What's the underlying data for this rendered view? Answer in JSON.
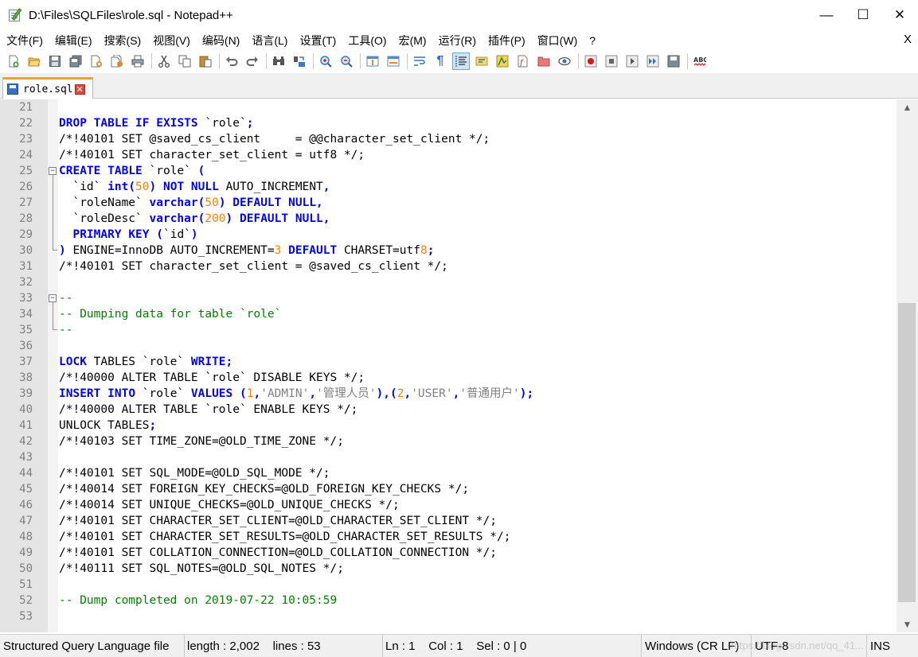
{
  "window": {
    "title": "D:\\Files\\SQLFiles\\role.sql - Notepad++",
    "minimize": "—",
    "maximize": "☐",
    "close": "✕"
  },
  "menu": {
    "items": [
      "文件(F)",
      "编辑(E)",
      "搜索(S)",
      "视图(V)",
      "编码(N)",
      "语言(L)",
      "设置(T)",
      "工具(O)",
      "宏(M)",
      "运行(R)",
      "插件(P)",
      "窗口(W)",
      "?"
    ],
    "close": "X"
  },
  "toolbar": {
    "buttons": [
      "new-file",
      "open-file",
      "save",
      "save-all",
      "close",
      "close-all",
      "print",
      "cut",
      "copy",
      "paste",
      "undo",
      "redo",
      "find",
      "replace",
      "zoom-in",
      "zoom-out",
      "sync-vertical",
      "sync-horizontal",
      "word-wrap",
      "show-all-chars",
      "indent-guide",
      "user-defined-language",
      "document-map",
      "function-list",
      "folder-as-workspace",
      "monitor",
      "macro-record",
      "macro-stop",
      "macro-play",
      "macro-run-multiple",
      "macro-save",
      "spell-check"
    ]
  },
  "tab": {
    "label": "role.sql",
    "close": "✕"
  },
  "editor": {
    "lines": [
      {
        "n": "21",
        "t": ""
      },
      {
        "n": "22",
        "t": "DROP TABLE IF EXISTS `role`;"
      },
      {
        "n": "23",
        "t": "/*!40101 SET @saved_cs_client     = @@character_set_client */;"
      },
      {
        "n": "24",
        "t": "/*!40101 SET character_set_client = utf8 */;"
      },
      {
        "n": "25",
        "t": "CREATE TABLE `role` ("
      },
      {
        "n": "26",
        "t": "  `id` int(50) NOT NULL AUTO_INCREMENT,"
      },
      {
        "n": "27",
        "t": "  `roleName` varchar(50) DEFAULT NULL,"
      },
      {
        "n": "28",
        "t": "  `roleDesc` varchar(200) DEFAULT NULL,"
      },
      {
        "n": "29",
        "t": "  PRIMARY KEY (`id`)"
      },
      {
        "n": "30",
        "t": ") ENGINE=InnoDB AUTO_INCREMENT=3 DEFAULT CHARSET=utf8;"
      },
      {
        "n": "31",
        "t": "/*!40101 SET character_set_client = @saved_cs_client */;"
      },
      {
        "n": "32",
        "t": ""
      },
      {
        "n": "33",
        "t": "--"
      },
      {
        "n": "34",
        "t": "-- Dumping data for table `role`"
      },
      {
        "n": "35",
        "t": "--"
      },
      {
        "n": "36",
        "t": ""
      },
      {
        "n": "37",
        "t": "LOCK TABLES `role` WRITE;"
      },
      {
        "n": "38",
        "t": "/*!40000 ALTER TABLE `role` DISABLE KEYS */;"
      },
      {
        "n": "39",
        "t": "INSERT INTO `role` VALUES (1,'ADMIN','管理人员'),(2,'USER','普通用户');"
      },
      {
        "n": "40",
        "t": "/*!40000 ALTER TABLE `role` ENABLE KEYS */;"
      },
      {
        "n": "41",
        "t": "UNLOCK TABLES;"
      },
      {
        "n": "42",
        "t": "/*!40103 SET TIME_ZONE=@OLD_TIME_ZONE */;"
      },
      {
        "n": "43",
        "t": ""
      },
      {
        "n": "44",
        "t": "/*!40101 SET SQL_MODE=@OLD_SQL_MODE */;"
      },
      {
        "n": "45",
        "t": "/*!40014 SET FOREIGN_KEY_CHECKS=@OLD_FOREIGN_KEY_CHECKS */;"
      },
      {
        "n": "46",
        "t": "/*!40014 SET UNIQUE_CHECKS=@OLD_UNIQUE_CHECKS */;"
      },
      {
        "n": "47",
        "t": "/*!40101 SET CHARACTER_SET_CLIENT=@OLD_CHARACTER_SET_CLIENT */;"
      },
      {
        "n": "48",
        "t": "/*!40101 SET CHARACTER_SET_RESULTS=@OLD_CHARACTER_SET_RESULTS */;"
      },
      {
        "n": "49",
        "t": "/*!40101 SET COLLATION_CONNECTION=@OLD_COLLATION_CONNECTION */;"
      },
      {
        "n": "50",
        "t": "/*!40111 SET SQL_NOTES=@OLD_SQL_NOTES */;"
      },
      {
        "n": "51",
        "t": ""
      },
      {
        "n": "52",
        "t": "-- Dump completed on 2019-07-22 10:05:59"
      },
      {
        "n": "53",
        "t": ""
      }
    ],
    "keywords": [
      "DROP",
      "TABLE",
      "IF",
      "EXISTS",
      "CREATE",
      "int",
      "NOT",
      "NULL",
      "varchar",
      "DEFAULT",
      "PRIMARY",
      "KEY",
      "LOCK",
      "WRITE",
      "INSERT",
      "INTO",
      "VALUES"
    ],
    "colors": {
      "keyword": "#0000ff",
      "number": "#ff8000",
      "string": "#808080",
      "comment": "#008000",
      "line_number": "#808080"
    }
  },
  "scrollbar": {
    "up": "▲",
    "down": "▼"
  },
  "status": {
    "language": "Structured Query Language file",
    "length": "length : 2,002",
    "lines": "lines : 53",
    "ln": "Ln : 1",
    "col": "Col : 1",
    "sel": "Sel : 0 | 0",
    "eol": "Windows (CR LF)",
    "encoding": "UTF-8",
    "mode": "INS",
    "watermark": "https://blog.csdn.net/qq_41..."
  }
}
